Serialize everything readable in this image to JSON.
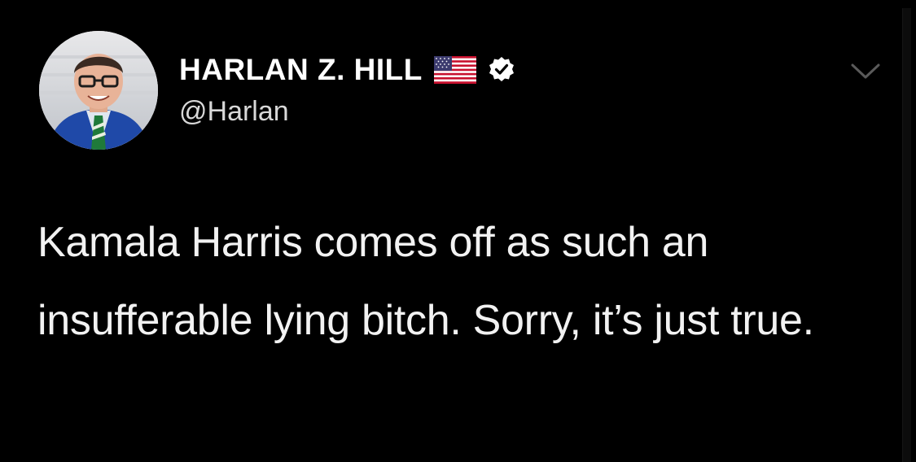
{
  "tweet": {
    "author": {
      "display_name": "HARLAN Z. HILL",
      "handle": "@Harlan",
      "badges": [
        "us-flag-icon",
        "verified-icon"
      ]
    },
    "text": "Kamala Harris comes off as such an insufferable lying bitch. Sorry, it’s just true.",
    "menu_icon": "chevron-down-icon"
  },
  "colors": {
    "background": "#000000",
    "text": "#f2f2f2",
    "handle": "#d8d8d8",
    "verified_badge": "#ffffff",
    "chevron": "#5a5a5a"
  }
}
